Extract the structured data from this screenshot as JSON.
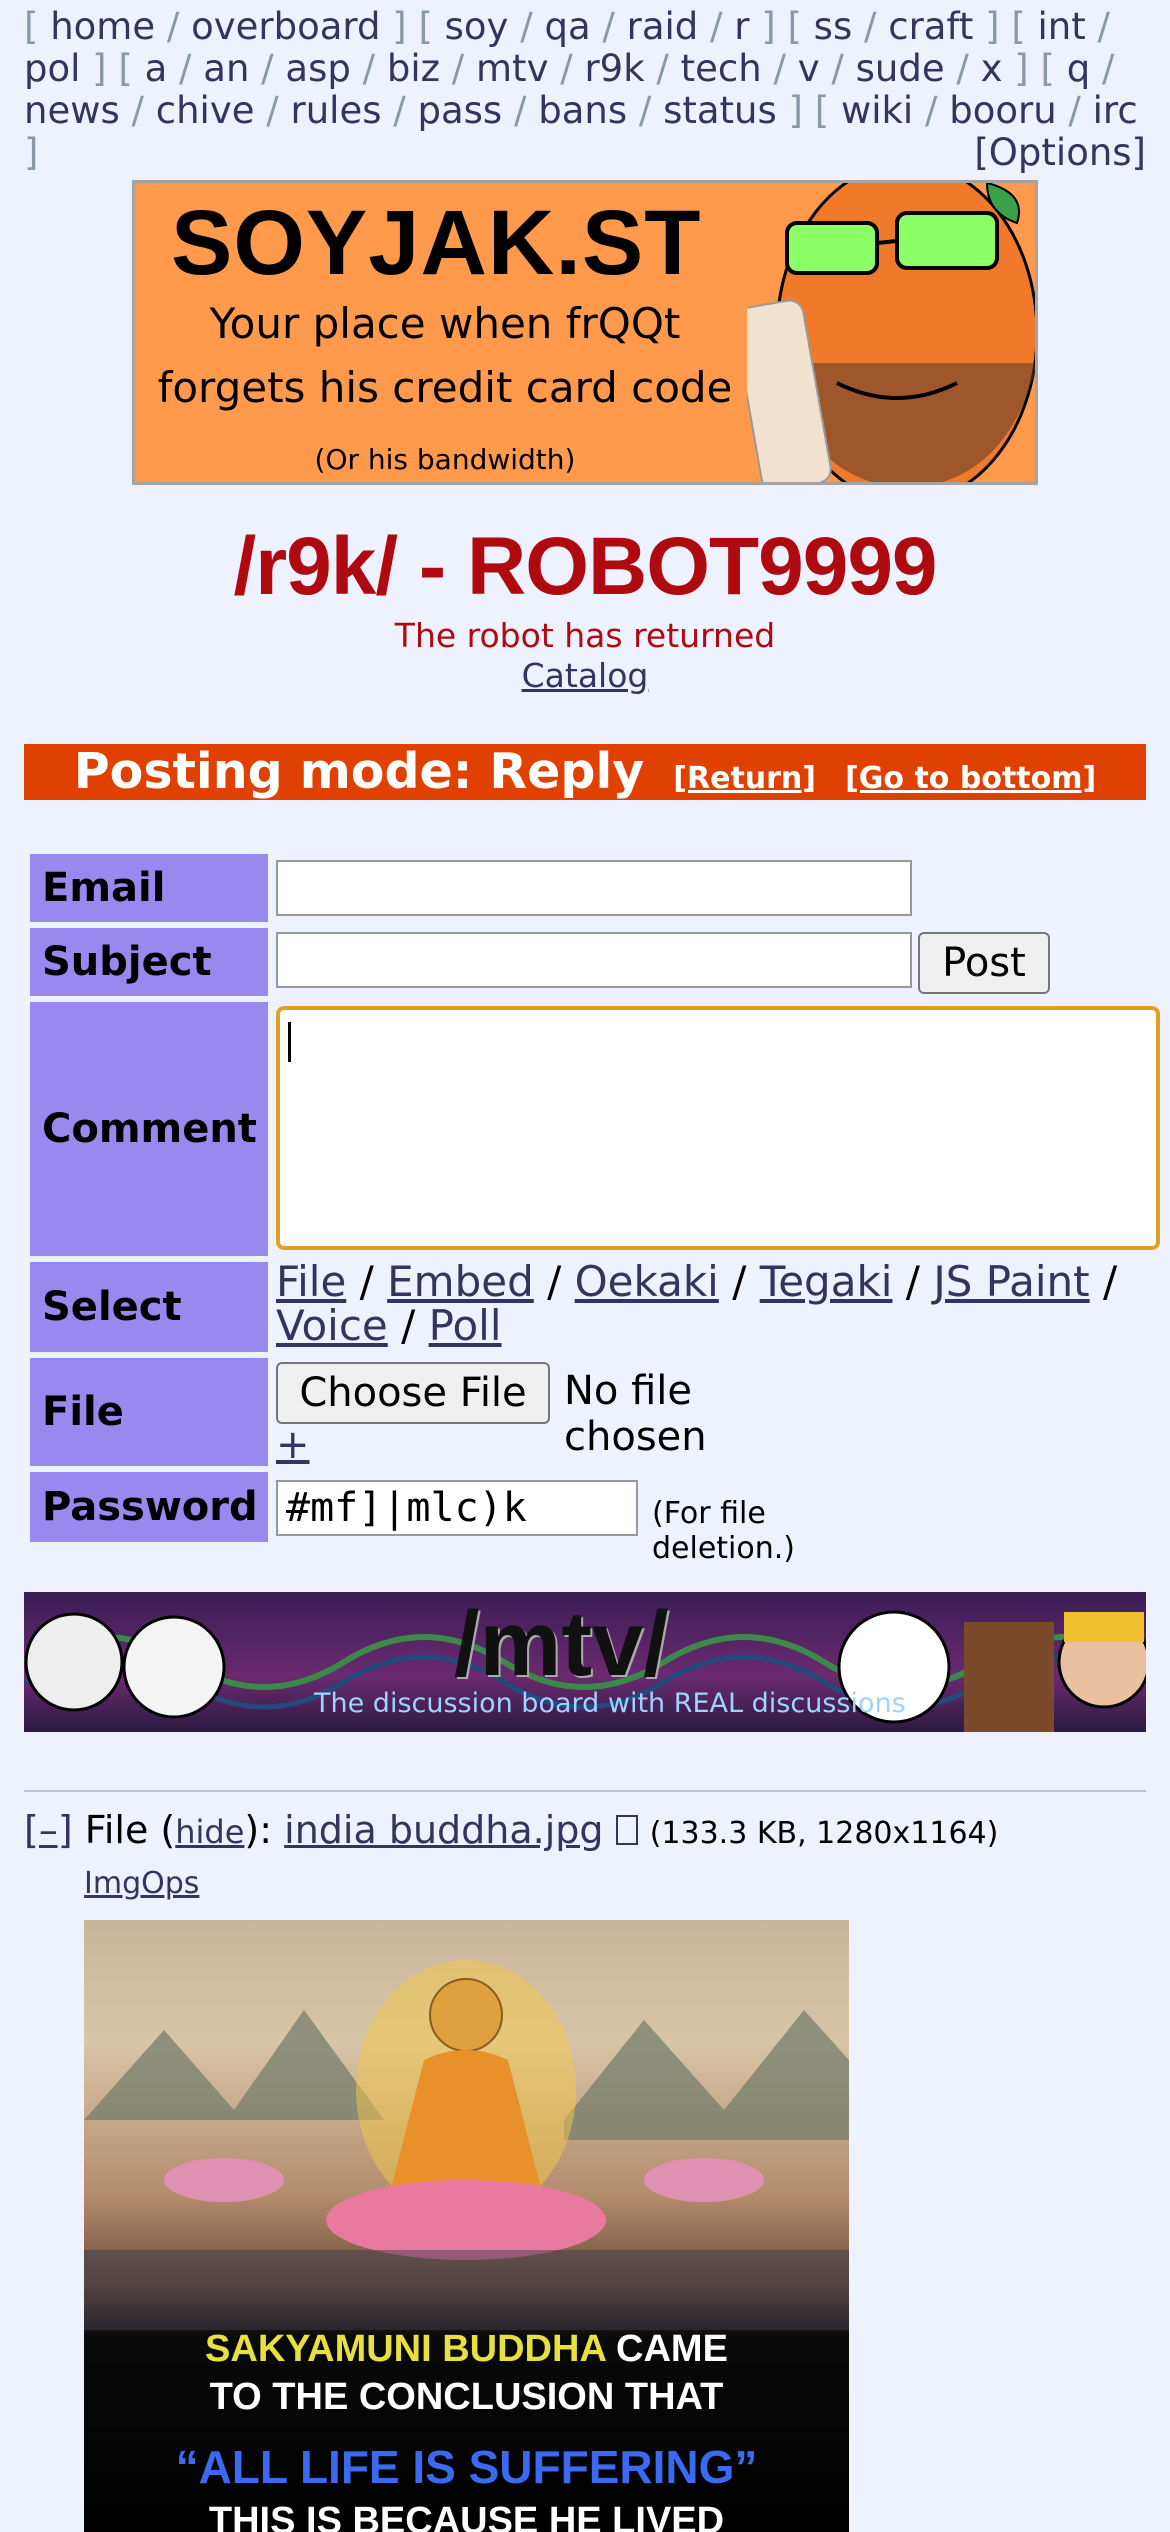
{
  "nav": {
    "groups": [
      [
        "home",
        "overboard"
      ],
      [
        "soy",
        "qa",
        "raid",
        "r"
      ],
      [
        "ss",
        "craft"
      ],
      [
        "int",
        "pol"
      ],
      [
        "a",
        "an",
        "asp",
        "biz",
        "mtv",
        "r9k",
        "tech",
        "v",
        "sude",
        "x"
      ],
      [
        "q",
        "news",
        "chive",
        "rules",
        "pass",
        "bans",
        "status"
      ],
      [
        "wiki",
        "booru",
        "irc"
      ]
    ],
    "options": "[Options]"
  },
  "banner": {
    "title": "SOYJAK.ST",
    "line1": "Your place when frQQt",
    "line2": "forgets his credit card code",
    "line3": "(Or his bandwidth)"
  },
  "board": {
    "title": "/r9k/ - ROBOT9999",
    "subtitle": "The robot has returned",
    "catalog": "Catalog"
  },
  "postmode": {
    "label": "Posting mode: Reply",
    "return": "[Return]",
    "bottom": "[Go to bottom]"
  },
  "form": {
    "email_label": "Email",
    "subject_label": "Subject",
    "post_button": "Post",
    "comment_label": "Comment",
    "select_label": "Select",
    "select_links": [
      "File",
      "Embed",
      "Oekaki",
      "Tegaki",
      "JS Paint",
      "Voice",
      "Poll"
    ],
    "file_label": "File",
    "choose_file": "Choose File",
    "no_file": "No file chosen",
    "plus": "+",
    "password_label": "Password",
    "password_value": "#mf]|mlc)k",
    "password_note": "(For file deletion.)"
  },
  "mtv_banner": {
    "title": "/mtv/",
    "subtitle": "The discussion board with REAL discussions"
  },
  "post": {
    "collapse": "[–]",
    "file_word": "File",
    "hide": "hide",
    "filename": "india buddha.jpg",
    "meta": "(133.3 KB, 1280x1164)",
    "imgops": "ImgOps",
    "caption1a": "SAKYAMUNI BUDDHA",
    "caption1b": " CAME",
    "caption2": "TO THE CONCLUSION THAT",
    "caption3": "“ALL LIFE IS SUFFERING”",
    "caption4": "THIS IS BECAUSE HE LIVED"
  }
}
